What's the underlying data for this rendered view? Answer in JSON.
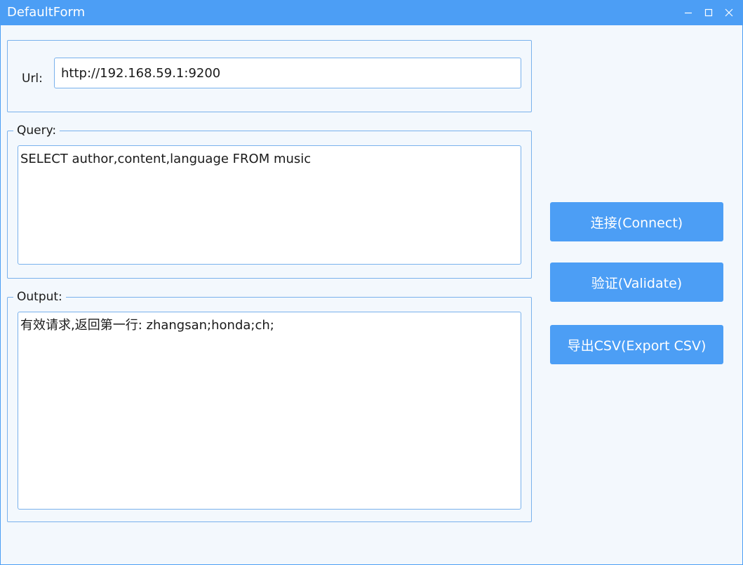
{
  "window": {
    "title": "DefaultForm"
  },
  "url": {
    "label": "Url:",
    "value": "http://192.168.59.1:9200"
  },
  "query": {
    "legend": "Query:",
    "value": "SELECT author,content,language FROM music"
  },
  "output": {
    "legend": "Output:",
    "value": "有效请求,返回第一行: zhangsan;honda;ch;"
  },
  "actions": {
    "connect_label": "连接(Connect)",
    "validate_label": "验证(Validate)",
    "export_label": "导出CSV(Export CSV)"
  },
  "theme": {
    "accent": "#4c9ef5",
    "background": "#f3f8fd",
    "border": "#79b1ec"
  }
}
